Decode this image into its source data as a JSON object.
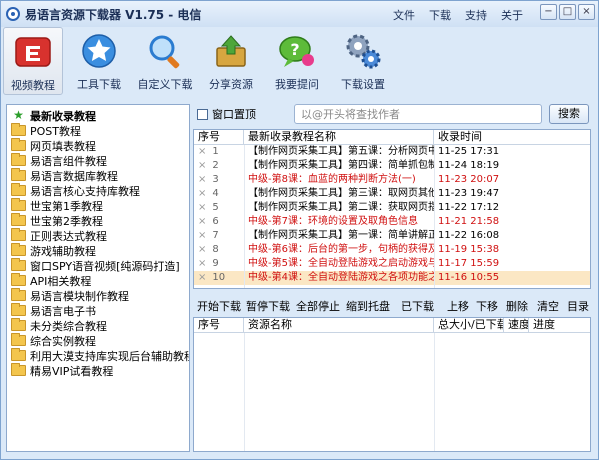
{
  "window": {
    "title": "易语言资源下载器 V1.75 - 电信",
    "menu": [
      "文件",
      "下载",
      "支持",
      "关于"
    ],
    "controls": [
      "−",
      "□",
      "×"
    ]
  },
  "toolbar": [
    {
      "label": "视频教程",
      "icon": "video-icon"
    },
    {
      "label": "工具下载",
      "icon": "star-download-icon"
    },
    {
      "label": "自定义下载",
      "icon": "magnifier-icon"
    },
    {
      "label": "分享资源",
      "icon": "share-icon"
    },
    {
      "label": "我要提问",
      "icon": "question-icon"
    },
    {
      "label": "下载设置",
      "icon": "gear-icon"
    }
  ],
  "tree": [
    "最新收录教程",
    "POST教程",
    "网页填表教程",
    "易语言组件教程",
    "易语言数据库教程",
    "易语言核心支持库教程",
    "世宝第1季教程",
    "世宝第2季教程",
    "正则表达式教程",
    "游戏辅助教程",
    "窗口SPY语音视频[纯源码打造]",
    "API相关教程",
    "易语言模块制作教程",
    "易语言电子书",
    "未分类综合教程",
    "综合实例教程",
    "利用大漠支持库实现后台辅助教程",
    "精易VIP试看教程"
  ],
  "search": {
    "checkbox_label": "窗口置顶",
    "placeholder": "以@开头将查找作者",
    "button": "搜索"
  },
  "list": {
    "headers": [
      "序号",
      "最新收录教程名称",
      "收录时间"
    ],
    "rows": [
      {
        "no": "1",
        "name": "【制作网页采集工具】第五课：分析网页中",
        "time": "11-25 17:31",
        "red": false
      },
      {
        "no": "2",
        "name": "【制作网页采集工具】第四课：简单抓包制",
        "time": "11-24 18:19",
        "red": false
      },
      {
        "no": "3",
        "name": "中级-第8课：血蓝的两种判断方法(一)",
        "time": "11-23 20:07",
        "red": true
      },
      {
        "no": "4",
        "name": "【制作网页采集工具】第三课：取网页其他",
        "time": "11-23 19:47",
        "red": false
      },
      {
        "no": "5",
        "name": "【制作网页采集工具】第二课：获取网页指",
        "time": "11-22 17:12",
        "red": false
      },
      {
        "no": "6",
        "name": "中级-第7课：环境的设置及取角色信息",
        "time": "11-21 21:58",
        "red": true
      },
      {
        "no": "7",
        "name": "【制作网页采集工具】第一课：简单讲解正",
        "time": "11-22 16:08",
        "red": false
      },
      {
        "no": "8",
        "name": "中级-第6课：后台的第一步，句柄的获得及",
        "time": "11-19 15:38",
        "red": true
      },
      {
        "no": "9",
        "name": "中级-第5课：全自动登陆游戏之启动游戏与",
        "time": "11-17 15:59",
        "red": true
      },
      {
        "no": "10",
        "name": "中级-第4课：全自动登陆游戏之各项功能之",
        "time": "11-16 10:55",
        "red": true,
        "selected": true
      }
    ]
  },
  "actions": [
    "开始下载",
    "暂停下载",
    "全部停止",
    "缩到托盘",
    "已下载",
    "上移",
    "下移",
    "删除",
    "清空",
    "目录"
  ],
  "download": {
    "headers": [
      "序号",
      "资源名称",
      "总大小/已下载",
      "速度",
      "进度"
    ]
  },
  "colors": {
    "accent": "#2a62b4",
    "red_text": "#d01010",
    "selected_row": "#fbe7c4",
    "background": "#dbe9f8"
  }
}
